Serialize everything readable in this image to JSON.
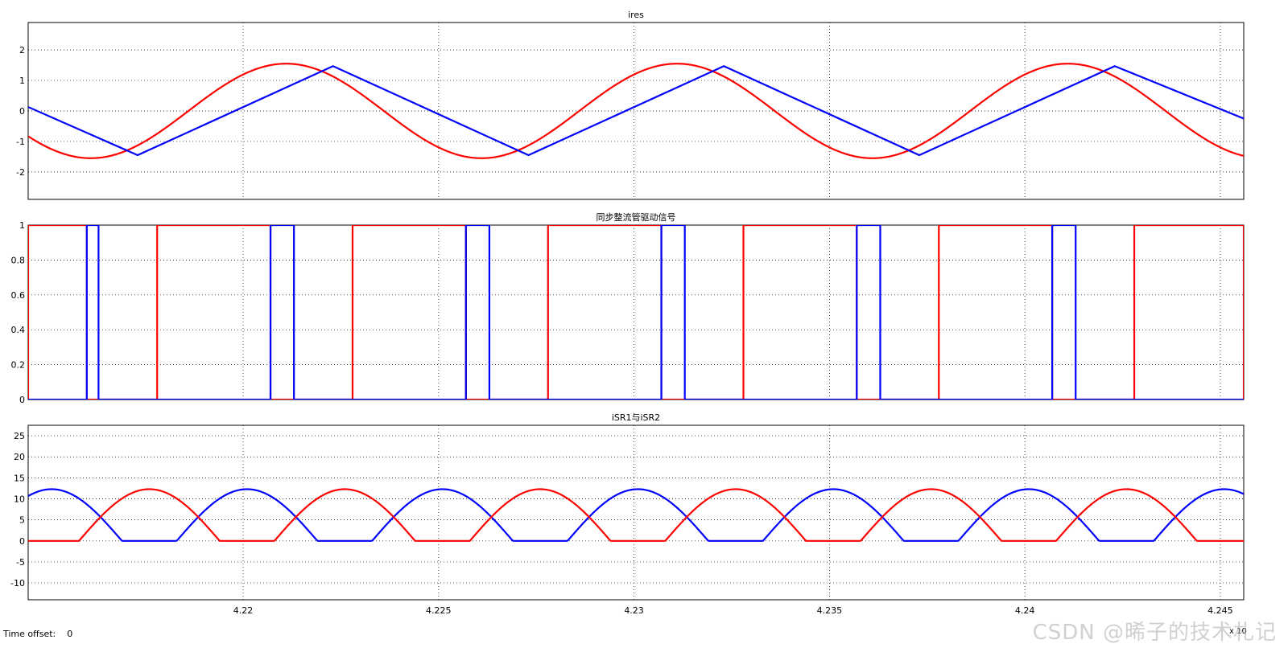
{
  "chart_data": [
    {
      "type": "line",
      "title": "ires",
      "xlim": [
        4.2145,
        4.2456
      ],
      "ylim": [
        -2.9,
        2.9
      ],
      "yticks": [
        -2,
        -1,
        0,
        1,
        2
      ],
      "yticklabels": [
        "-2",
        "-1",
        "0",
        "1",
        "2"
      ],
      "grid": true,
      "series": [
        {
          "color": "#ff0000",
          "style": "sine",
          "amplitude": 1.55,
          "peaks_at": [
            4.2211,
            4.2261,
            4.2311
          ],
          "valleys_at": [
            4.2161,
            4.2211,
            4.2261
          ],
          "sample_points": [
            [
              4.2145,
              -0.55
            ],
            [
              4.2161,
              -1.53
            ],
            [
              4.2186,
              0.0
            ],
            [
              4.2211,
              1.55
            ],
            [
              4.2236,
              0.0
            ],
            [
              4.2261,
              -1.53
            ],
            [
              4.2286,
              0.0
            ],
            [
              4.2311,
              1.55
            ],
            [
              4.2336,
              0.0
            ],
            [
              4.2361,
              -1.53
            ],
            [
              4.2386,
              0.0
            ],
            [
              4.2411,
              1.55
            ],
            [
              4.2436,
              0.0
            ],
            [
              4.2456,
              -1.1
            ]
          ]
        },
        {
          "color": "#0000ff",
          "style": "triangle",
          "vertices": [
            [
              4.2145,
              0.13
            ],
            [
              4.2173,
              -1.45
            ],
            [
              4.2223,
              1.47
            ],
            [
              4.2273,
              -1.45
            ],
            [
              4.2323,
              1.47
            ],
            [
              4.2373,
              -1.45
            ],
            [
              4.2423,
              1.47
            ],
            [
              4.2456,
              -0.25
            ]
          ]
        }
      ]
    },
    {
      "type": "line",
      "title": "同步整流管驱动信号",
      "xlim": [
        4.2145,
        4.2456
      ],
      "ylim": [
        0,
        1
      ],
      "yticks": [
        0,
        0.2,
        0.4,
        0.6,
        0.8,
        1
      ],
      "yticklabels": [
        "0",
        "0.2",
        "0.4",
        "0.6",
        "0.8",
        "1"
      ],
      "grid": true,
      "series": [
        {
          "color": "#ff0000",
          "style": "step",
          "high_intervals": [
            [
              4.2145,
              4.216
            ],
            [
              4.2178,
              4.2207
            ],
            [
              4.2228,
              4.2257
            ],
            [
              4.2278,
              4.2307
            ],
            [
              4.2328,
              4.2357
            ],
            [
              4.2378,
              4.2407
            ],
            [
              4.2428,
              4.2456
            ]
          ],
          "comment_note": null
        },
        {
          "color": "#0000ff",
          "style": "step",
          "high_intervals": [
            [
              4.216,
              4.2163
            ],
            [
              4.2207,
              4.2213
            ],
            [
              4.2257,
              4.2263
            ],
            [
              4.2307,
              4.2313
            ],
            [
              4.2357,
              4.2363
            ],
            [
              4.2407,
              4.2413
            ]
          ]
        }
      ]
    },
    {
      "type": "line",
      "title": "iSR1与iSR2",
      "xlim": [
        4.2145,
        4.2456
      ],
      "ylim": [
        -14,
        27.5
      ],
      "yticks": [
        -10,
        -5,
        0,
        5,
        10,
        15,
        20,
        25
      ],
      "yticklabels": [
        "-10",
        "-5",
        "0",
        "5",
        "10",
        "15",
        "20",
        "25"
      ],
      "xticks": [
        4.22,
        4.225,
        4.23,
        4.235,
        4.24,
        4.245
      ],
      "xticklabels": [
        "4.22",
        "4.225",
        "4.23",
        "4.235",
        "4.24",
        "4.245"
      ],
      "xscale_label": "x 10",
      "grid": true,
      "series": [
        {
          "color": "#0000ff",
          "style": "half-sine",
          "amplitude": 12.3,
          "humps": [
            [
              4.2133,
              4.2169
            ],
            [
              4.2183,
              4.2219
            ],
            [
              4.2233,
              4.2269
            ],
            [
              4.2283,
              4.2319
            ],
            [
              4.2333,
              4.2369
            ],
            [
              4.2383,
              4.2419
            ],
            [
              4.2433,
              4.2469
            ]
          ]
        },
        {
          "color": "#ff0000",
          "style": "half-sine",
          "amplitude": 12.3,
          "humps": [
            [
              4.2158,
              4.2194
            ],
            [
              4.2208,
              4.2244
            ],
            [
              4.2258,
              4.2294
            ],
            [
              4.2308,
              4.2344
            ],
            [
              4.2358,
              4.2394
            ],
            [
              4.2408,
              4.2444
            ]
          ]
        }
      ]
    }
  ],
  "status": {
    "time_offset_label": "Time offset:",
    "time_offset_value": "0"
  },
  "watermark": "CSDN @晞子的技术札记",
  "colors": {
    "red": "#ff0000",
    "blue": "#0000ff",
    "grid": "#000000",
    "background": "#ffffff"
  }
}
